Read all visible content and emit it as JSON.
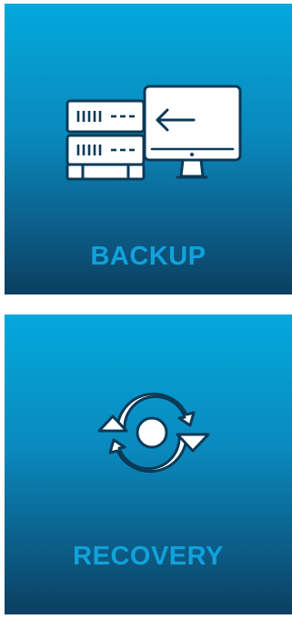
{
  "colors": {
    "gradient_top": "#03a8dc",
    "gradient_bottom": "#0c3f60",
    "label": "#10a2dc",
    "icon_stroke": "#0b3a57",
    "icon_fill": "#ffffff"
  },
  "tiles": [
    {
      "id": "backup",
      "label": "BACKUP",
      "icon": "server-to-monitor-backup-icon"
    },
    {
      "id": "recovery",
      "label": "RECOVERY",
      "icon": "circular-arrows-recovery-icon"
    }
  ]
}
